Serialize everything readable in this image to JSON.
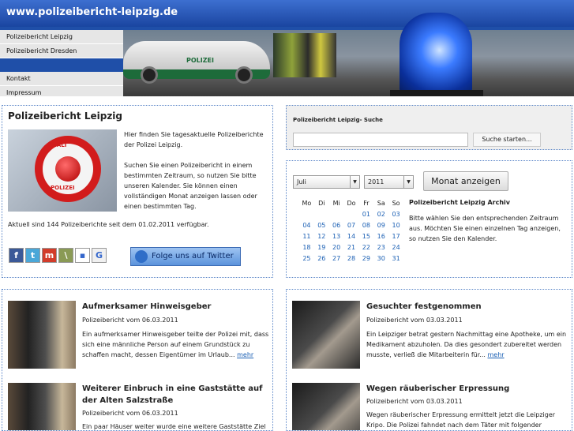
{
  "header": {
    "site_title": "www.polizeibericht-leipzig.de",
    "car_label": "POLIZEI"
  },
  "nav": {
    "items": [
      "Polizeibericht Leipzig",
      "Polizeibericht Dresden",
      "Kontakt",
      "Impressum"
    ]
  },
  "intro": {
    "title": "Polizeibericht Leipzig",
    "image_text": {
      "top": "HALT",
      "bottom": "POLIZEI"
    },
    "paragraph1": "Hier finden Sie tagesaktuelle Polizeiberichte der Polizei Leipzig.",
    "paragraph2": "Suchen Sie einen Polizeibericht in einem bestimmten Zeitraum, so nutzen Sie bitte unseren Kalender. Sie können einen vollständigen Monat anzeigen lassen oder einen bestimmten Tag.",
    "count": "Aktuell sind 144 Polizeiberichte seit dem 01.02.2011 verfügbar.",
    "social_icons": [
      "facebook-icon",
      "twitter-icon",
      "mister-wong-icon",
      "digg-icon",
      "delicious-icon",
      "google-icon"
    ],
    "social_glyphs": [
      "f",
      "t",
      "m",
      "\\",
      "▪",
      "G"
    ],
    "social_colors": [
      "#3b5998",
      "#4aa7d8",
      "#d23c2a",
      "#8a9a55",
      "#ffffff",
      "#f0f0f0"
    ],
    "twitter_button": "Folge uns auf Twitter"
  },
  "search": {
    "label": "Polizeibericht Leipzig- Suche",
    "input_value": "",
    "button": "Suche starten..."
  },
  "calendar": {
    "month": "Juli",
    "year": "2011",
    "button": "Monat anzeigen",
    "weekdays": [
      "Mo",
      "Di",
      "Mi",
      "Do",
      "Fr",
      "Sa",
      "So"
    ],
    "weeks": [
      [
        "",
        "",
        "",
        "",
        "01",
        "02",
        "03"
      ],
      [
        "04",
        "05",
        "06",
        "07",
        "08",
        "09",
        "10"
      ],
      [
        "11",
        "12",
        "13",
        "14",
        "15",
        "16",
        "17"
      ],
      [
        "18",
        "19",
        "20",
        "21",
        "22",
        "23",
        "24"
      ],
      [
        "25",
        "26",
        "27",
        "28",
        "29",
        "30",
        "31"
      ]
    ],
    "archive_title": "Polizeibericht Leipzig Archiv",
    "archive_text": "Bitte wählen Sie den entsprechenden Zeitraum aus. Möchten Sie einen einzelnen Tag anzeigen, so nutzen Sie den Kalender."
  },
  "articles_left": [
    {
      "title": "Aufmerksamer Hinweisgeber",
      "date": "Polizeibericht vom 06.03.2011",
      "text": "Ein aufmerksamer Hinweisgeber teilte der Polizei mit, dass sich eine männliche Person auf einem Grundstück zu schaffen macht, dessen Eigentümer im Urlaub...",
      "more": "mehr"
    },
    {
      "title": "Weiterer Einbruch in eine Gaststätte auf der Alten Salzstraße",
      "date": "Polizeibericht vom 06.03.2011",
      "text": "Ein paar Häuser weiter wurde eine weitere Gaststätte Ziel",
      "more": ""
    }
  ],
  "articles_right": [
    {
      "title": "Gesuchter festgenommen",
      "date": "Polizeibericht vom 03.03.2011",
      "text": "Ein Leipziger betrat gestern Nachmittag eine Apotheke, um ein Medikament abzuholen. Da dies gesondert zubereitet werden musste, verließ die Mitarbeiterin für...",
      "more": "mehr"
    },
    {
      "title": "Wegen räuberischer Erpressung",
      "date": "Polizeibericht vom 03.03.2011",
      "text": "Wegen räuberischer Erpressung ermittelt jetzt die Leipziger Kripo. Die Polizei fahndet nach dem Täter mit folgender",
      "more": ""
    }
  ]
}
